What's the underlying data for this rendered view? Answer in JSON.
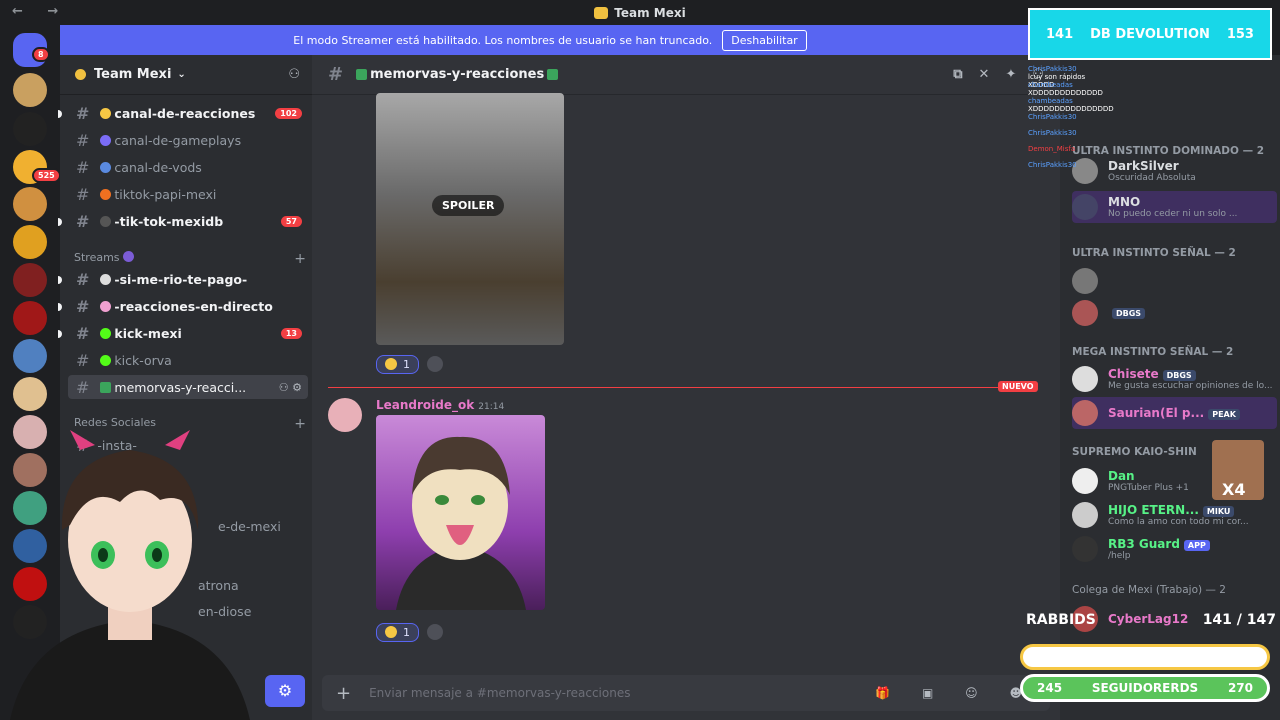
{
  "window": {
    "title": "Team Mexi",
    "nav": "← →"
  },
  "banner": {
    "text": "El modo Streamer está habilitado. Los nombres de usuario se han truncado.",
    "button": "Deshabilitar"
  },
  "rail": {
    "badges": [
      "8",
      "525"
    ]
  },
  "server": {
    "name": "Team Mexi"
  },
  "channels": [
    {
      "name": "canal-de-reacciones",
      "count": "102"
    },
    {
      "name": "canal-de-gameplays"
    },
    {
      "name": "canal-de-vods"
    },
    {
      "name": "tiktok-papi-mexi"
    },
    {
      "name": "-tik-tok-mexidb",
      "count": "57"
    }
  ],
  "categories": {
    "streams": "Streams",
    "redes": "Redes Sociales"
  },
  "stream_channels": [
    {
      "name": "-si-me-rio-te-pago-"
    },
    {
      "name": "-reacciones-en-directo"
    },
    {
      "name": "kick-mexi",
      "count": "13"
    },
    {
      "name": "kick-orva"
    },
    {
      "name": "memorvas-y-reacci..."
    }
  ],
  "social_channels": [
    {
      "name": "-insta-"
    },
    {
      "name": "e-de-mexi"
    },
    {
      "name": "atrona"
    },
    {
      "name": "en-diose"
    }
  ],
  "chat": {
    "channel": "memorvas-y-reacciones",
    "spoiler": "SPOILER",
    "reaction_count": "1",
    "new_label": "NUEVO",
    "author": "Leandroide_ok",
    "time": "21:14",
    "placeholder": "Enviar mensaje a #memorvas-y-reacciones"
  },
  "members": {
    "categories": [
      "ULTRA INSTINTO DOMINADO — 2",
      "ULTRA INSTINTO SEÑAL — 2",
      "MEGA INSTINTO SEÑAL — 2",
      "SUPREMO KAIO-SHIN",
      "Colega de Mexi (Trabajo) — 2"
    ],
    "list": [
      {
        "name": "DarkSilver",
        "status": "Oscuridad Absoluta",
        "color": "#dbdee1"
      },
      {
        "name": "MNO",
        "status": "No puedo ceder ni un solo ...",
        "color": "#dbdee1"
      },
      {
        "name": "Chisete",
        "tag": "DBGS",
        "status": "Me gusta escuchar opiniones de lo...",
        "color": "#e879c9"
      },
      {
        "name": "Saurian(El p...",
        "tag": "PEAK",
        "status": "",
        "color": "#e879c9"
      },
      {
        "name": "Dan",
        "status": "PNGTuber Plus +1",
        "color": "#57f287"
      },
      {
        "name": "HIJO ETERN...",
        "tag": "MIKU",
        "status": "Como la amo con todo mi cor...",
        "color": "#57f287"
      },
      {
        "name": "RB3 Guard",
        "tag": "APP",
        "status": "/help",
        "color": "#57f287"
      },
      {
        "name": "CyberLag12",
        "status": "",
        "color": "#e879c9"
      }
    ],
    "extra_tag": "DBGS"
  },
  "overlay": {
    "top_left": "141",
    "top_title": "DB DEVOLUTION",
    "top_right": "153",
    "chat_lines": [
      {
        "user": "ChrisPakkis30",
        "msg": "lcuy son rápidos XDDDD"
      },
      {
        "user": "chambeadas",
        "msg": "XDDDDDDDDDDDDD"
      },
      {
        "user": "chambeadas",
        "msg": "XDDDDDDDDDDDDDDD"
      },
      {
        "user": "ChrisPakkis30",
        "msg": ""
      },
      {
        "user": "ChrisPakkis30",
        "msg": ""
      },
      {
        "user": "Demon_Misfa",
        "msg": ""
      },
      {
        "user": "ChrisPakkis30",
        "msg": ""
      }
    ],
    "sub_label": "RABBIDS",
    "sub_value": "141 / 147",
    "follow_left": "245",
    "follow_label": "SEGUIDORERDS",
    "follow_right": "270",
    "multiplier": "X4"
  },
  "colors": {
    "accent": "#5865f2",
    "banner": "#5865f2",
    "overlay_cyan": "#18d7e8",
    "danger": "#f23f43"
  }
}
